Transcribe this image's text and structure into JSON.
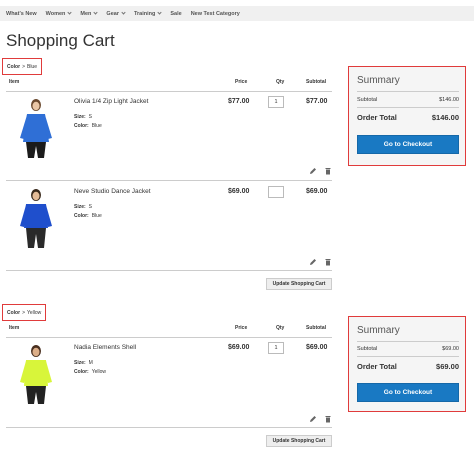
{
  "nav": {
    "items": [
      {
        "label": "What's New",
        "has_dropdown": false
      },
      {
        "label": "Women",
        "has_dropdown": true
      },
      {
        "label": "Men",
        "has_dropdown": true
      },
      {
        "label": "Gear",
        "has_dropdown": true
      },
      {
        "label": "Training",
        "has_dropdown": true
      },
      {
        "label": "Sale",
        "has_dropdown": false
      },
      {
        "label": "New Test Category",
        "has_dropdown": false
      }
    ]
  },
  "page_title": "Shopping Cart",
  "columns": {
    "item": "Item",
    "price": "Price",
    "qty": "Qty",
    "subtotal": "Subtotal"
  },
  "update_button": "Update Shopping Cart",
  "option_labels": {
    "size": "Size:",
    "color": "Color:"
  },
  "groups": [
    {
      "filter_name": "Color",
      "filter_sep": ">",
      "filter_value": "Blue",
      "items": [
        {
          "name": "Olivia 1/4 Zip Light Jacket",
          "size": "S",
          "color": "Blue",
          "price": "$77.00",
          "qty": "1",
          "subtotal": "$77.00",
          "image_color": "#2f6fd6"
        },
        {
          "name": "Neve Studio Dance Jacket",
          "size": "S",
          "color": "Blue",
          "price": "$69.00",
          "qty": "",
          "subtotal": "$69.00",
          "image_color": "#1f4fcc"
        }
      ],
      "summary": {
        "title": "Summary",
        "subtotal_label": "Subtotal",
        "subtotal": "$146.00",
        "total_label": "Order Total",
        "total": "$146.00",
        "checkout": "Go to Checkout"
      }
    },
    {
      "filter_name": "Color",
      "filter_sep": ">",
      "filter_value": "Yellow",
      "items": [
        {
          "name": "Nadia Elements Shell",
          "size": "M",
          "color": "Yellow",
          "price": "$69.00",
          "qty": "1",
          "subtotal": "$69.00",
          "image_color": "#d8f53a"
        }
      ],
      "summary": {
        "title": "Summary",
        "subtotal_label": "Subtotal",
        "subtotal": "$69.00",
        "total_label": "Order Total",
        "total": "$69.00",
        "checkout": "Go to Checkout"
      }
    }
  ],
  "colors": {
    "accent_button": "#1979c3",
    "highlight_border": "#e03b3b"
  },
  "icons": {
    "edit": "pencil-icon",
    "delete": "trash-icon"
  }
}
